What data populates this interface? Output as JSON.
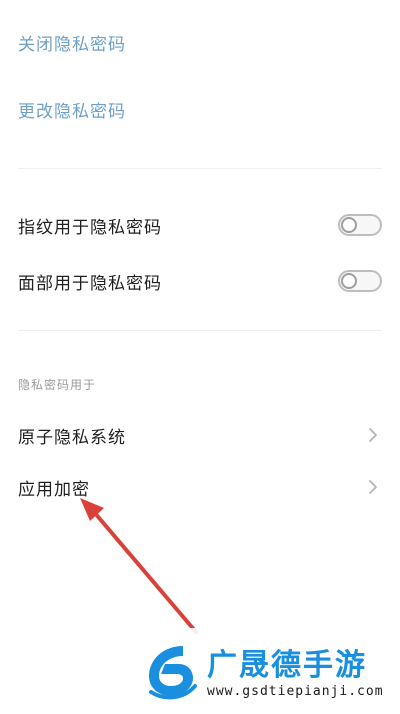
{
  "privacy": {
    "close_password": "关闭隐私密码",
    "change_password": "更改隐私密码"
  },
  "biometric": {
    "fingerprint_label": "指纹用于隐私密码",
    "fingerprint_enabled": false,
    "face_label": "面部用于隐私密码",
    "face_enabled": false
  },
  "usage": {
    "section_title": "隐私密码用于",
    "items": [
      {
        "label": "原子隐私系统"
      },
      {
        "label": "应用加密"
      }
    ]
  },
  "watermark": {
    "title": "广晟德手游",
    "url": "www.gsdtiepianji.com"
  },
  "colors": {
    "link": "#6d9fc7",
    "arrow": "#d9413a",
    "watermark_blue": "#1a8fe0"
  },
  "icons": {
    "chevron": "chevron-right-icon",
    "annotation": "red-arrow-icon",
    "logo": "site-logo-icon"
  }
}
